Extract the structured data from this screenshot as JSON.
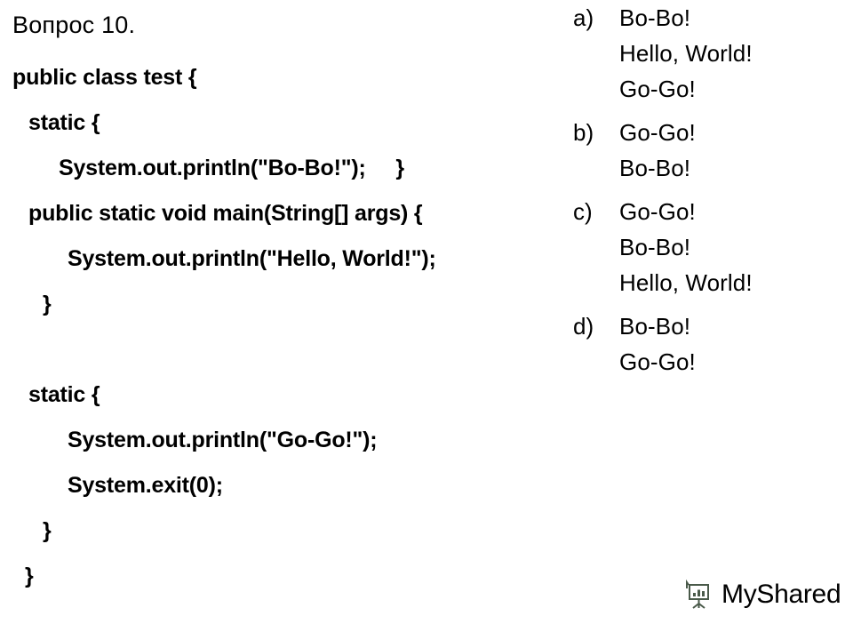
{
  "slide": {
    "question_title": "Вопрос 10.",
    "code_lines": [
      {
        "text": "public class test {",
        "indent": 14
      },
      {
        "text": "static {",
        "indent": 32
      },
      {
        "text": "System.out.println(\"Bo-Bo!\");     }",
        "indent": 66
      },
      {
        "text": "public static void main(String[] args) {",
        "indent": 32
      },
      {
        "text": "System.out.println(\"Hello, World!\");",
        "indent": 76
      },
      {
        "text": "}",
        "indent": 48
      },
      {
        "text": "",
        "indent": 0
      },
      {
        "text": "static {",
        "indent": 32
      },
      {
        "text": "System.out.println(\"Go-Go!\");",
        "indent": 76
      },
      {
        "text": "System.exit(0);",
        "indent": 76
      },
      {
        "text": "}",
        "indent": 48
      },
      {
        "text": "}",
        "indent": 28
      }
    ],
    "options": [
      {
        "label": "a)",
        "lines": [
          "Bo-Bo!",
          "Hello, World!",
          "Go-Go!"
        ]
      },
      {
        "label": "b)",
        "lines": [
          "Go-Go!",
          "Bo-Bo!"
        ]
      },
      {
        "label": "c)",
        "lines": [
          "Go-Go!",
          "Bo-Bo!",
          "Hello, World!"
        ]
      },
      {
        "label": "d)",
        "lines": [
          "Bo-Bo!",
          "Go-Go!"
        ]
      }
    ],
    "watermark": {
      "text": "MyShared",
      "icon": "presentation-board-icon",
      "color": "#4a5a4a"
    },
    "colors": {
      "background": "#ffffff",
      "text": "#000000",
      "watermark": "#4a5a4a"
    }
  }
}
